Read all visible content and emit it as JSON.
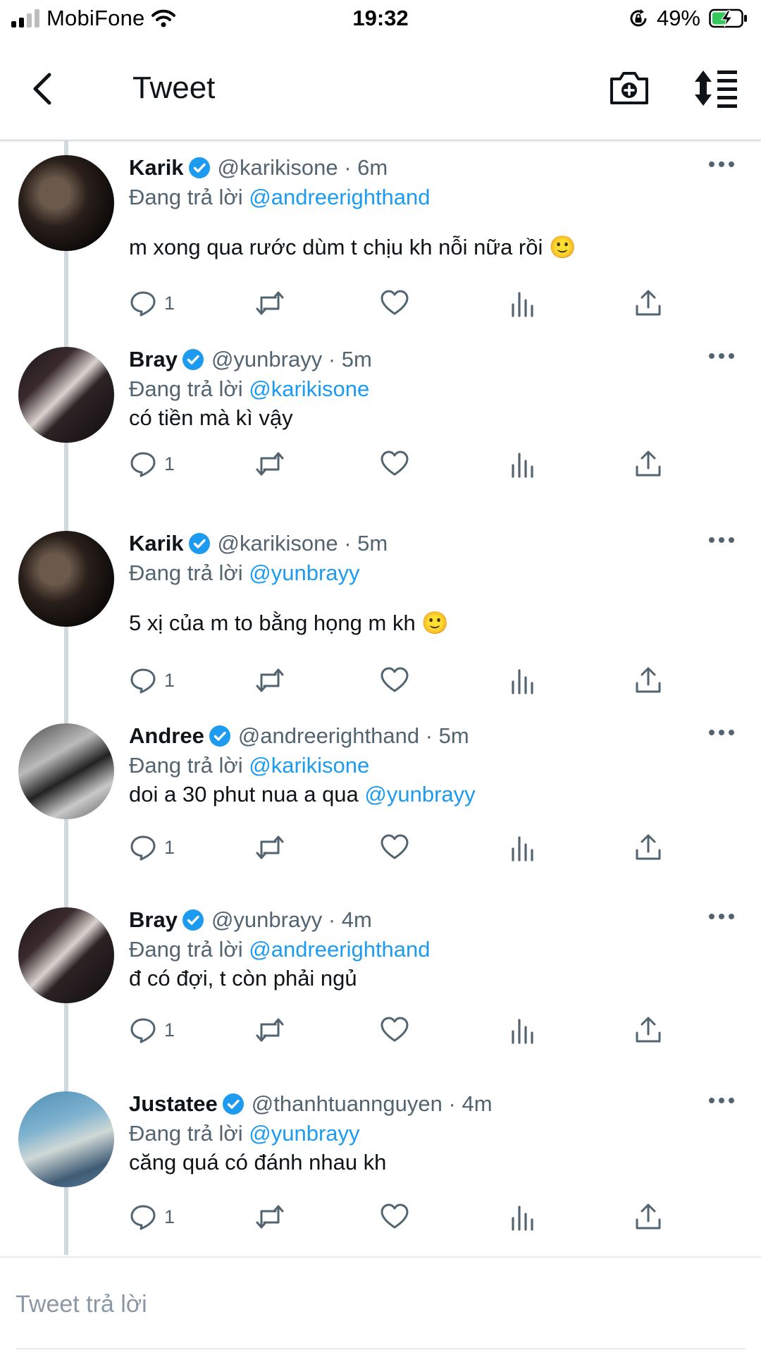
{
  "status_bar": {
    "carrier": "MobiFone",
    "time": "19:32",
    "battery": "49%"
  },
  "header": {
    "title": "Tweet"
  },
  "tweets": [
    {
      "author": "Karik",
      "handle": "@karikisone",
      "time": "· 6m",
      "reply_label": "Đang trả lời",
      "reply_to": "@andreerighthand",
      "text": "m xong qua rước dùm t chịu kh nỗi nữa rồi 🙂",
      "text_mention": "",
      "reply_count": "1"
    },
    {
      "author": "Bray",
      "handle": "@yunbrayy",
      "time": "· 5m",
      "reply_label": "Đang trả lời",
      "reply_to": "@karikisone",
      "text": "có tiền mà kì vậy",
      "text_mention": "",
      "reply_count": "1"
    },
    {
      "author": "Karik",
      "handle": "@karikisone",
      "time": "· 5m",
      "reply_label": "Đang trả lời",
      "reply_to": "@yunbrayy",
      "text": "5 xị của m to bằng họng m kh 🙂",
      "text_mention": "",
      "reply_count": "1"
    },
    {
      "author": "Andree",
      "handle": "@andreerighthand",
      "time": "· 5m",
      "reply_label": "Đang trả lời",
      "reply_to": "@karikisone",
      "text": "doi a 30 phut nua a qua ",
      "text_mention": "@yunbrayy",
      "reply_count": "1"
    },
    {
      "author": "Bray",
      "handle": "@yunbrayy",
      "time": "· 4m",
      "reply_label": "Đang trả lời",
      "reply_to": "@andreerighthand",
      "text": "đ có đợi, t còn phải ngủ",
      "text_mention": "",
      "reply_count": "1"
    },
    {
      "author": "Justatee",
      "handle": "@thanhtuannguyen",
      "time": "· 4m",
      "reply_label": "Đang trả lời",
      "reply_to": "@yunbrayy",
      "text": "căng quá có đánh nhau kh",
      "text_mention": "",
      "reply_count": "1"
    }
  ],
  "composer": {
    "placeholder": "Tweet trả lời"
  },
  "colors": {
    "accent": "#1d9bf0",
    "secondary_text": "#536471",
    "thread_line": "#cfd9de"
  },
  "icons": [
    "back-arrow-icon",
    "camera-plus-icon",
    "sort-list-icon",
    "verified-badge-icon",
    "more-dots-icon",
    "reply-icon",
    "retweet-icon",
    "like-icon",
    "analytics-icon",
    "share-icon",
    "wifi-icon",
    "rotation-lock-icon",
    "battery-charging-icon"
  ]
}
